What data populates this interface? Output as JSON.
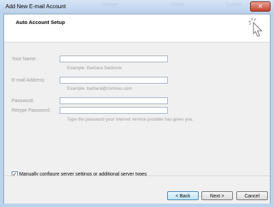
{
  "window": {
    "title": "Add New E-mail Account",
    "close_glyph": "✕"
  },
  "titlebar_ghost": [
    "Change",
    "Close",
    "Cancel"
  ],
  "header": {
    "title": "Auto Account Setup",
    "icon": "click-cursor-icon"
  },
  "form": {
    "name": {
      "label": "Your Name:",
      "value": "",
      "hint": "Example: Barbara Sankovic"
    },
    "email": {
      "label": "E-mail Address:",
      "value": "",
      "hint": "Example: barbara@contoso.com"
    },
    "password": {
      "label": "Password:",
      "value": ""
    },
    "retype": {
      "label": "Retype Password:",
      "value": "",
      "hint": "Type the password your Internet service provider has given you."
    }
  },
  "manual": {
    "checked": true,
    "check_glyph": "✓",
    "label": "Manually configure server settings or additional server types"
  },
  "buttons": {
    "back": "< Back",
    "next": "Next >",
    "cancel": "Cancel"
  },
  "colors": {
    "titlebar": "#bcd3ec",
    "close": "#c7422a",
    "panel": "#f0f0f0",
    "field_border": "#a6b1bf"
  }
}
